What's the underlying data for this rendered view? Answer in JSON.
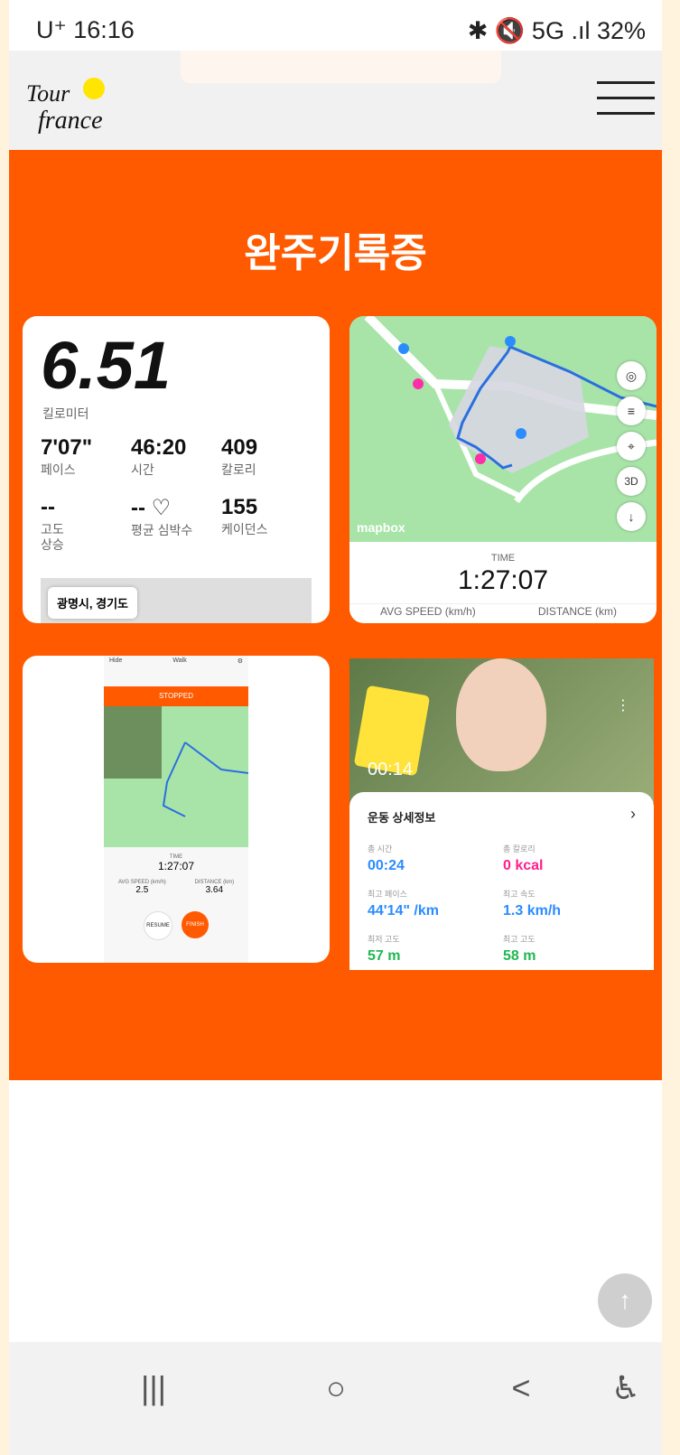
{
  "status": {
    "carrier_time": "U⁺ 16:16",
    "right_icons": "✱ 🔇 5G .ıl 32%"
  },
  "header": {
    "logo_text": "Tour de France",
    "menu_icon": "hamburger-icon"
  },
  "orange_section": {
    "title": "완주기록증",
    "card1": {
      "distance": "6.51",
      "distance_unit": "킬로미터",
      "stats": [
        {
          "value": "7'07\"",
          "label": "페이스"
        },
        {
          "value": "46:20",
          "label": "시간"
        },
        {
          "value": "409",
          "label": "칼로리"
        },
        {
          "value": "--",
          "label": "고도\n상승"
        },
        {
          "value": "-- ♡",
          "label": "평균 심박수"
        },
        {
          "value": "155",
          "label": "케이던스"
        }
      ],
      "location": "광명시, 경기도"
    },
    "card2": {
      "time_label": "TIME",
      "time_value": "1:27:07",
      "avg_speed_label": "AVG SPEED (km/h)",
      "distance_label": "DISTANCE (km)",
      "mapbox": "mapbox"
    },
    "card3": {
      "header_left": "Hide",
      "header_mid": "Walk",
      "stopped": "STOPPED",
      "time_label": "TIME",
      "time_value": "1:27:07",
      "avg_speed_label": "AVG SPEED (km/h)",
      "avg_speed_value": "2.5",
      "distance_label": "DISTANCE (km)",
      "distance_value": "3.64",
      "resume": "RESUME",
      "finish": "FINISH"
    },
    "card4": {
      "timer": "00:14",
      "detail_title": "운동 상세정보",
      "stats": [
        {
          "label": "총 시간",
          "value": "00:24",
          "color": "#2a8cff"
        },
        {
          "label": "총 칼로리",
          "value": "0 kcal",
          "color": "#ff1f8b"
        },
        {
          "label": "최고 페이스",
          "value": "44'14\" /km",
          "color": "#2a8cff"
        },
        {
          "label": "최고 속도",
          "value": "1.3 km/h",
          "color": "#2a8cff"
        },
        {
          "label": "최저 고도",
          "value": "57 m",
          "color": "#1fb84f"
        },
        {
          "label": "최고 고도",
          "value": "58 m",
          "color": "#1fb84f"
        }
      ]
    }
  },
  "floating": {
    "scroll_top_icon": "up-arrow-icon"
  },
  "navbar": {
    "recent": "|||",
    "home": "○",
    "back": "<",
    "accessibility": "accessibility-icon"
  }
}
